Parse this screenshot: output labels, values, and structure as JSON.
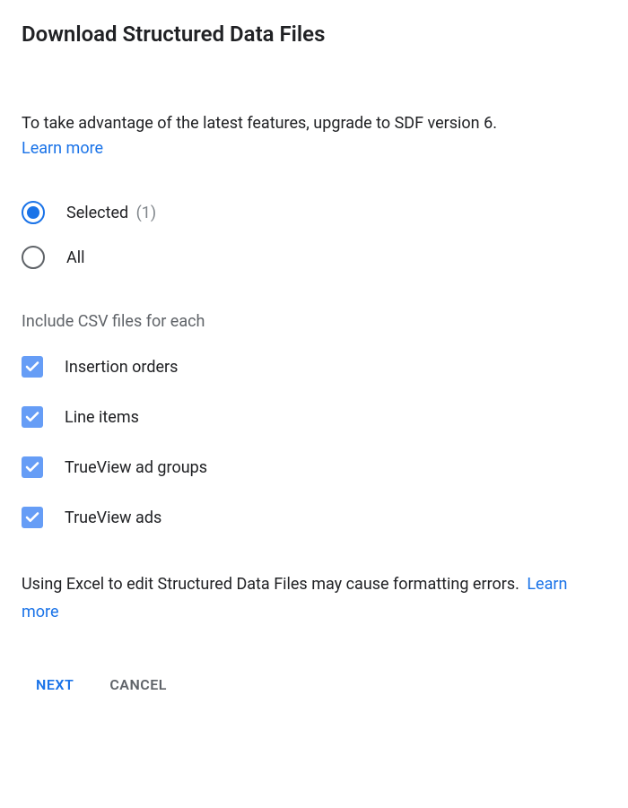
{
  "dialog": {
    "title": "Download Structured Data Files"
  },
  "upgrade": {
    "message": "To take advantage of the latest features, upgrade to SDF version 6.",
    "link": "Learn more"
  },
  "scope": {
    "selected_label": "Selected",
    "selected_count": "(1)",
    "all_label": "All"
  },
  "include": {
    "section_label": "Include CSV files for each",
    "items": [
      {
        "label": "Insertion orders"
      },
      {
        "label": "Line items"
      },
      {
        "label": "TrueView ad groups"
      },
      {
        "label": "TrueView ads"
      }
    ]
  },
  "warning": {
    "text": "Using Excel to edit Structured Data Files may cause formatting errors.",
    "link": "Learn more"
  },
  "buttons": {
    "next": "NEXT",
    "cancel": "CANCEL"
  }
}
